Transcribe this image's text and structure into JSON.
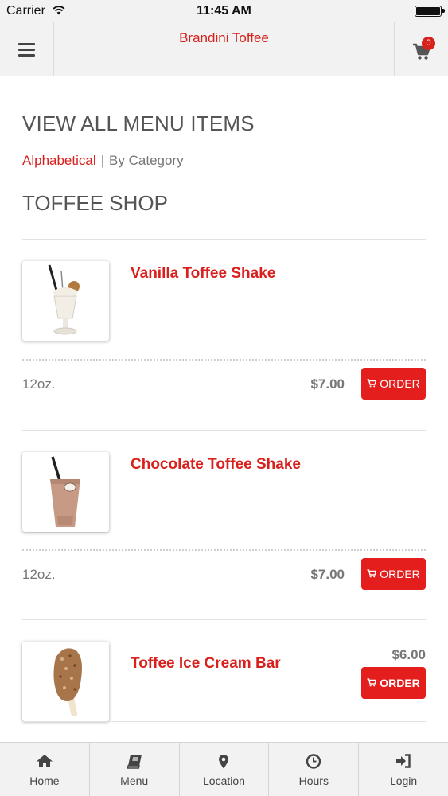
{
  "status_bar": {
    "carrier": "Carrier",
    "time": "11:45 AM"
  },
  "header": {
    "title": "Brandini Toffee",
    "cart_count": "0"
  },
  "page": {
    "title": "VIEW ALL MENU ITEMS",
    "sort_active": "Alphabetical",
    "sort_separator": "|",
    "sort_other": "By Category",
    "section_title": "TOFFEE SHOP"
  },
  "items": [
    {
      "name": "Vanilla Toffee Shake",
      "size": "12oz.",
      "price": "$7.00",
      "order_label": "ORDER"
    },
    {
      "name": "Chocolate Toffee Shake",
      "size": "12oz.",
      "price": "$7.00",
      "order_label": "ORDER"
    },
    {
      "name": "Toffee Ice Cream Bar",
      "size": "",
      "price": "$6.00",
      "order_label": "ORDER"
    }
  ],
  "tabs": [
    {
      "label": "Home",
      "icon": "home-icon"
    },
    {
      "label": "Menu",
      "icon": "book-icon"
    },
    {
      "label": "Location",
      "icon": "map-pin-icon"
    },
    {
      "label": "Hours",
      "icon": "clock-icon"
    },
    {
      "label": "Login",
      "icon": "login-icon"
    }
  ],
  "colors": {
    "accent": "#d9201d",
    "button": "#e41e1c",
    "bar": "#f2f2f2"
  }
}
